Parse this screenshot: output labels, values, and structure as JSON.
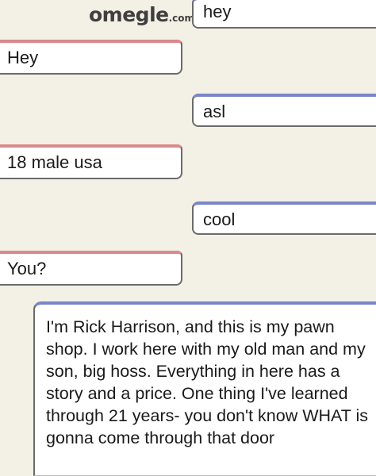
{
  "logo": {
    "word": "omegle",
    "domain": ".com"
  },
  "messages": [
    {
      "from": "you",
      "text": "hey"
    },
    {
      "from": "stranger",
      "text": "Hey"
    },
    {
      "from": "you",
      "text": "asl"
    },
    {
      "from": "stranger",
      "text": "18 male usa"
    },
    {
      "from": "you",
      "text": "cool"
    },
    {
      "from": "stranger",
      "text": "You?"
    },
    {
      "from": "you",
      "text": "I'm Rick Harrison, and this is my pawn shop. I work here with my old man and my son, big hoss. Everything in here has a story and a price. One thing I've learned through 21 years- you don't know WHAT is gonna come through that door"
    }
  ],
  "colors": {
    "background": "#f3f0e6",
    "stranger_accent": "#d98a8a",
    "you_accent": "#7a86c8"
  }
}
